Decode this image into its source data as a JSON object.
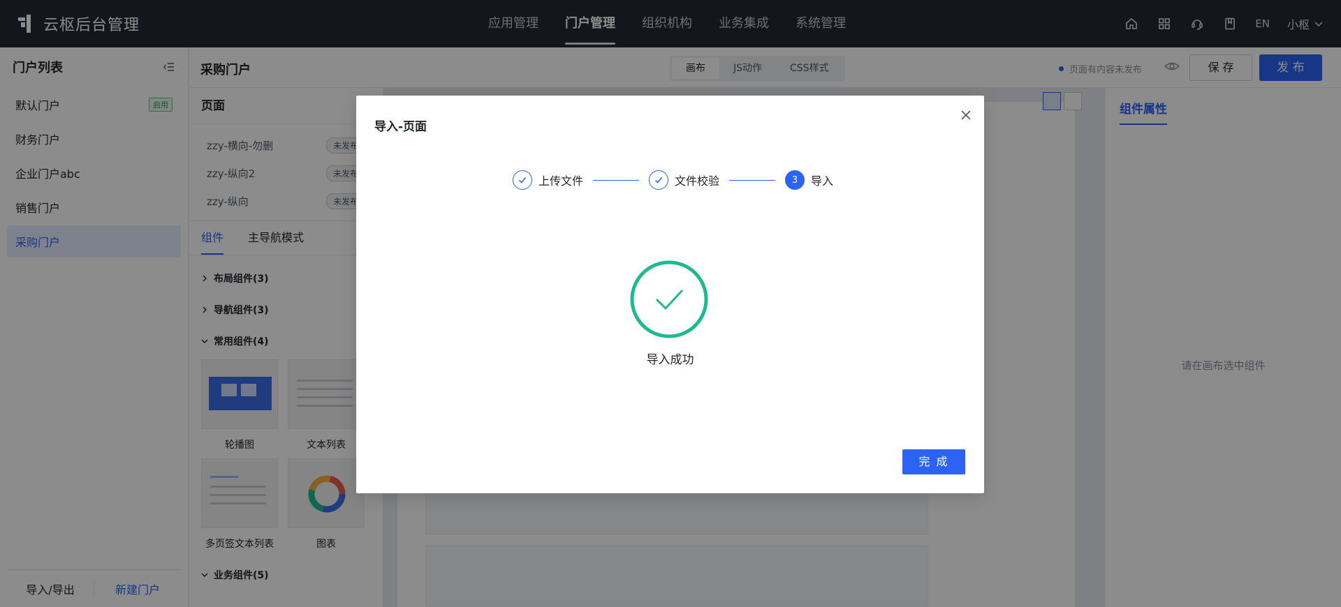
{
  "app": {
    "title": "云枢后台管理"
  },
  "topnav": {
    "items": [
      "应用管理",
      "门户管理",
      "组织机构",
      "业务集成",
      "系统管理"
    ],
    "active": "门户管理"
  },
  "topright": {
    "lang": "EN",
    "user": "小枢"
  },
  "sidebar": {
    "title": "门户列表",
    "items": [
      {
        "label": "默认门户",
        "badge": "启用"
      },
      {
        "label": "财务门户"
      },
      {
        "label": "企业门户abc"
      },
      {
        "label": "销售门户"
      },
      {
        "label": "采购门户"
      }
    ],
    "active": "采购门户",
    "footer": {
      "import_export": "导入/导出",
      "new_portal": "新建门户"
    }
  },
  "editor": {
    "title": "采购门户",
    "modes": [
      "画布",
      "JS动作",
      "CSS样式"
    ],
    "active_mode": "画布",
    "status": "页面有内容未发布",
    "save": "保 存",
    "publish": "发 布"
  },
  "pages": {
    "title": "页面",
    "items": [
      {
        "label": "zzy-横向-勿删",
        "status": "未发布"
      },
      {
        "label": "zzy-纵向2",
        "status": "未发布"
      },
      {
        "label": "zzy-纵向",
        "status": "未发布"
      }
    ]
  },
  "components": {
    "tabs": [
      "组件",
      "主导航模式"
    ],
    "active_tab": "组件",
    "groups": {
      "layout": "布局组件(3)",
      "nav": "导航组件(3)",
      "common": "常用组件(4)",
      "business": "业务组件(5)"
    },
    "thumbs": [
      "轮播图",
      "文本列表",
      "多页签文本列表",
      "图表"
    ]
  },
  "props": {
    "tab": "组件属性",
    "empty": "请在画布选中组件"
  },
  "modal": {
    "title": "导入-页面",
    "steps": [
      {
        "label": "上传文件",
        "state": "done"
      },
      {
        "label": "文件校验",
        "state": "done"
      },
      {
        "label": "导入",
        "state": "current",
        "number": "3"
      }
    ],
    "result": "导入成功",
    "done_button": "完 成"
  },
  "colors": {
    "primary": "#2d63f5",
    "success": "#1dba8f",
    "topbar": "#232a36"
  }
}
